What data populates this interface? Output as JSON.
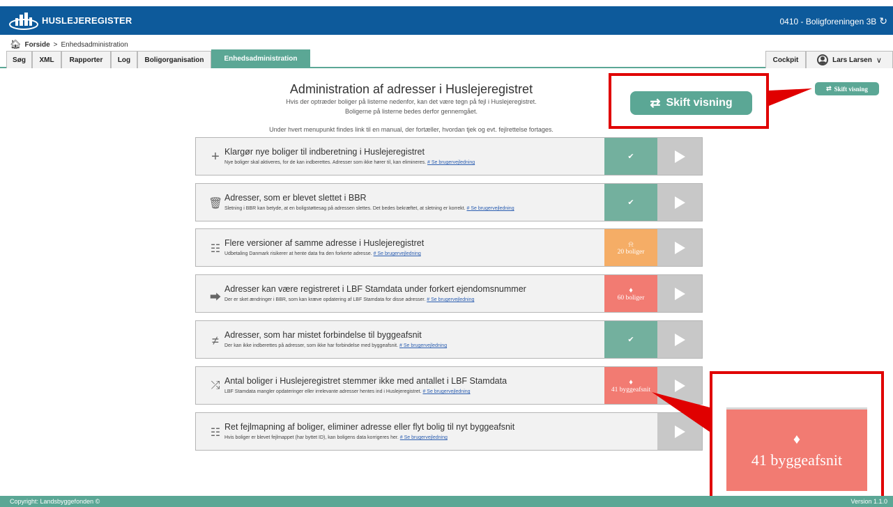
{
  "header": {
    "app_name": "HUSLEJEREGISTER",
    "organization": "0410 - Boligforeningen 3B",
    "refresh_icon": "refresh-icon"
  },
  "breadcrumb": {
    "home": "Forside",
    "separator": ">",
    "current": "Enhedsadministration"
  },
  "tabs": [
    {
      "label": "Søg",
      "active": false
    },
    {
      "label": "XML",
      "active": false
    },
    {
      "label": "Rapporter",
      "active": false
    },
    {
      "label": "Log",
      "active": false
    },
    {
      "label": "Boligorganisation",
      "active": false
    },
    {
      "label": "Enhedsadministration",
      "active": true
    }
  ],
  "right_tabs": {
    "cockpit": "Cockpit",
    "user": "Lars Larsen"
  },
  "main": {
    "title": "Administration af adresser i Huslejeregistret",
    "intro_1": "Hvis der optræder boliger på listerne nedenfor, kan det være tegn på fejl i Huslejeregistret.",
    "intro_2": "Boligerne på listerne bedes derfor gennemgået.",
    "intro_3": "Under hvert menupunkt findes link til en manual, der fortæller, hvordan tjek og evt. fejlrettelse fortages.",
    "switch_view": "Skift visning",
    "link_label": "Se brugervejledning"
  },
  "rows": [
    {
      "icon": "plus-icon",
      "title": "Klargør nye boliger til indberetning i Huslejeregistret",
      "desc": "Nye boliger skal aktiveres, for de kan indberettes. Adresser som ikke hører til, kan elimineres.",
      "status": "ok",
      "status_text": ""
    },
    {
      "icon": "trash-icon",
      "title": "Adresser, som er blevet slettet i BBR",
      "desc": "Sletning i BBR kan betyde, at en boligstøttesag på adressen slettes. Det bedes bekræftet, at sletning er korrekt.",
      "status": "ok",
      "status_text": ""
    },
    {
      "icon": "hierarchy-icon",
      "title": "Flere versioner af samme adresse i Huslejeregistret",
      "desc": "Udbetaling Danmark risikerer at hente data fra den forkerte adresse.",
      "status": "warn",
      "status_text": "20 boliger"
    },
    {
      "icon": "share-icon",
      "title": "Adresser kan være registreret i LBF Stamdata under forkert ejendomsnummer",
      "desc": "Der er sket ændringer i BBR, som kan kræve opdatering af LBF Stamdata for disse adresser.",
      "status": "err",
      "status_text": "60 boliger"
    },
    {
      "icon": "signpost-icon",
      "title": "Adresser, som har mistet forbindelse til byggeafsnit",
      "desc": "Der kan ikke indberettes på adresser, som ikke har forbindelse med byggeafsnit.",
      "status": "ok",
      "status_text": ""
    },
    {
      "icon": "shuffle-icon",
      "title": "Antal boliger i Huslejeregistret stemmer ikke med antallet i LBF Stamdata",
      "desc": "LBF Stamdata mangler opdateringer eller irrelevante adresser hentes ind i Huslejeregistret.",
      "status": "err",
      "status_text": "41 byggeafsnit"
    },
    {
      "icon": "sliders-icon",
      "title": "Ret fejlmapning af boliger, eliminer adresse eller flyt bolig til nyt byggeafsnit",
      "desc": "Hvis boliger er blevet fejlmappet (har byttet ID), kan boligens data korrigeres her.",
      "status": "none",
      "status_text": ""
    }
  ],
  "zoom_callout": {
    "text": "41 byggeafsnit"
  },
  "footer": {
    "copyright": "Copyright: Landsbyggefonden ©",
    "version": "Version 1.1.0"
  },
  "colors": {
    "header_blue": "#0d5a9b",
    "teal": "#5ba795",
    "ok": "#73b09e",
    "warn": "#f5ad66",
    "err": "#f27b72",
    "callout_red": "#e00000"
  }
}
